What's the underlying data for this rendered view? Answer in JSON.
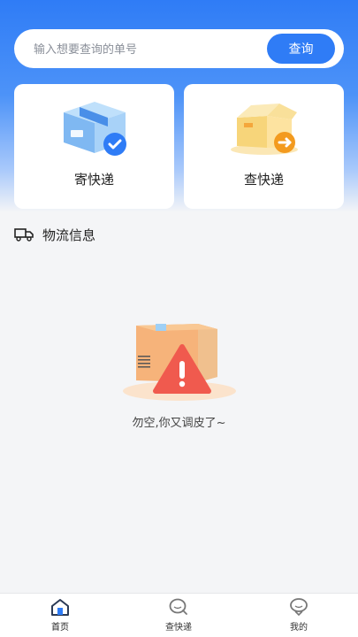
{
  "search": {
    "placeholder": "输入想要查询的单号",
    "button_label": "查询"
  },
  "cards": [
    {
      "label": "寄快递",
      "icon": "send-package-icon"
    },
    {
      "label": "查快递",
      "icon": "open-package-icon"
    }
  ],
  "section": {
    "title": "物流信息",
    "icon": "truck-icon"
  },
  "empty_state": {
    "message": "勿空,你又调皮了~",
    "icon": "empty-box-warning-icon"
  },
  "tabbar": {
    "items": [
      {
        "label": "首页",
        "icon": "home-icon",
        "active": true
      },
      {
        "label": "查快递",
        "icon": "search-icon",
        "active": false
      },
      {
        "label": "我的",
        "icon": "profile-icon",
        "active": false
      }
    ]
  },
  "colors": {
    "accent": "#2f7cf6",
    "background": "#f4f5f7",
    "card": "#ffffff"
  }
}
